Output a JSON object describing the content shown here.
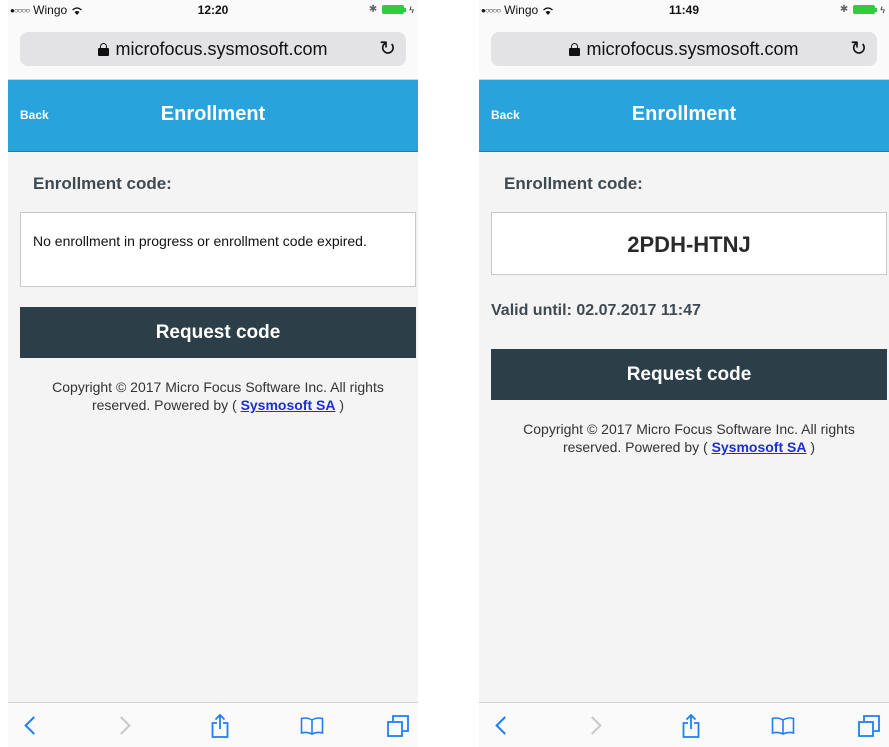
{
  "colors": {
    "header_blue": "#29a3db",
    "button_dark": "#2c3e47",
    "link_blue": "#1a2fd6",
    "ios_tint": "#1f7ef5"
  },
  "screens": [
    {
      "status": {
        "carrier": "Wingo",
        "time": "12:20"
      },
      "url": "microfocus.sysmosoft.com",
      "header": {
        "back": "Back",
        "title": "Enrollment"
      },
      "label": "Enrollment code:",
      "message": "No enrollment in progress or enrollment code expired.",
      "button": "Request code",
      "copyright": "Copyright © 2017 Micro Focus Software Inc. All rights reserved. Powered by (",
      "link": "Sysmosoft SA",
      "copyright_end": ")"
    },
    {
      "status": {
        "carrier": "Wingo",
        "time": "11:49"
      },
      "url": "microfocus.sysmosoft.com",
      "header": {
        "back": "Back",
        "title": "Enrollment"
      },
      "label": "Enrollment code:",
      "code": "2PDH-HTNJ",
      "valid_until": "Valid until: 02.07.2017 11:47",
      "button": "Request code",
      "copyright": "Copyright © 2017 Micro Focus Software Inc. All rights reserved. Powered by (",
      "link": "Sysmosoft SA",
      "copyright_end": ")"
    }
  ],
  "icons": {
    "signal": "signal-dots-icon",
    "wifi": "wifi-icon",
    "bluetooth": "bluetooth-icon",
    "battery": "battery-icon",
    "lock": "lock-icon",
    "reload": "reload-icon",
    "back": "chevron-left-icon",
    "forward": "chevron-right-icon",
    "share": "share-icon",
    "bookmarks": "book-icon",
    "tabs": "tabs-icon"
  }
}
